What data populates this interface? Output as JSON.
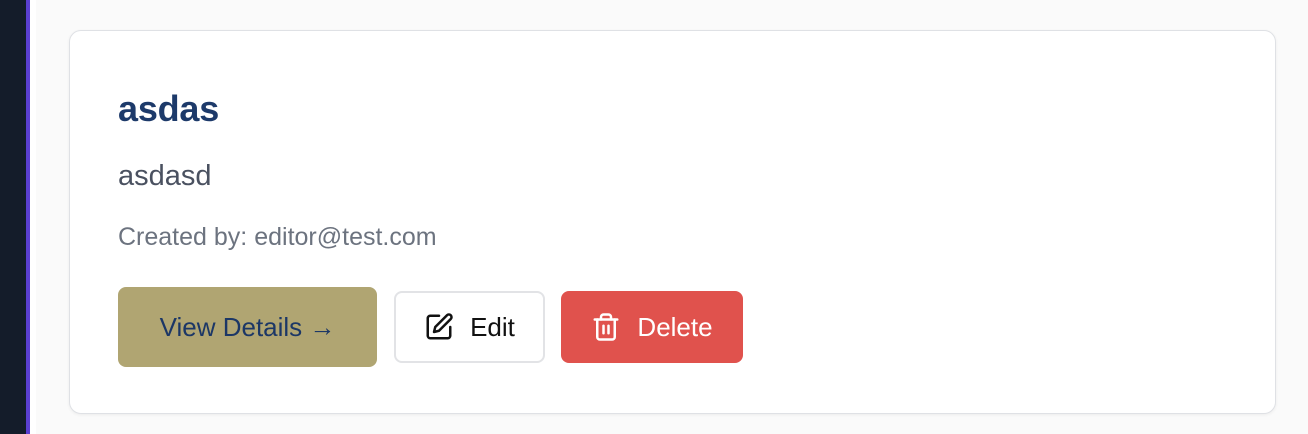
{
  "card": {
    "title": "asdas",
    "description": "asdasd",
    "created_by_label": "Created by:",
    "created_by_value": "editor@test.com"
  },
  "actions": {
    "view_details_label": "View Details →",
    "edit_label": "Edit",
    "delete_label": "Delete"
  },
  "icons": {
    "edit": "edit-icon",
    "delete": "trash-icon"
  },
  "colors": {
    "title": "#1d3a6a",
    "view_button_bg": "#b0a572",
    "view_button_text": "#1c3766",
    "delete_button_bg": "#e0524d",
    "sidebar_bg": "#141c2a",
    "sidebar_accent": "#5b3fd0"
  }
}
